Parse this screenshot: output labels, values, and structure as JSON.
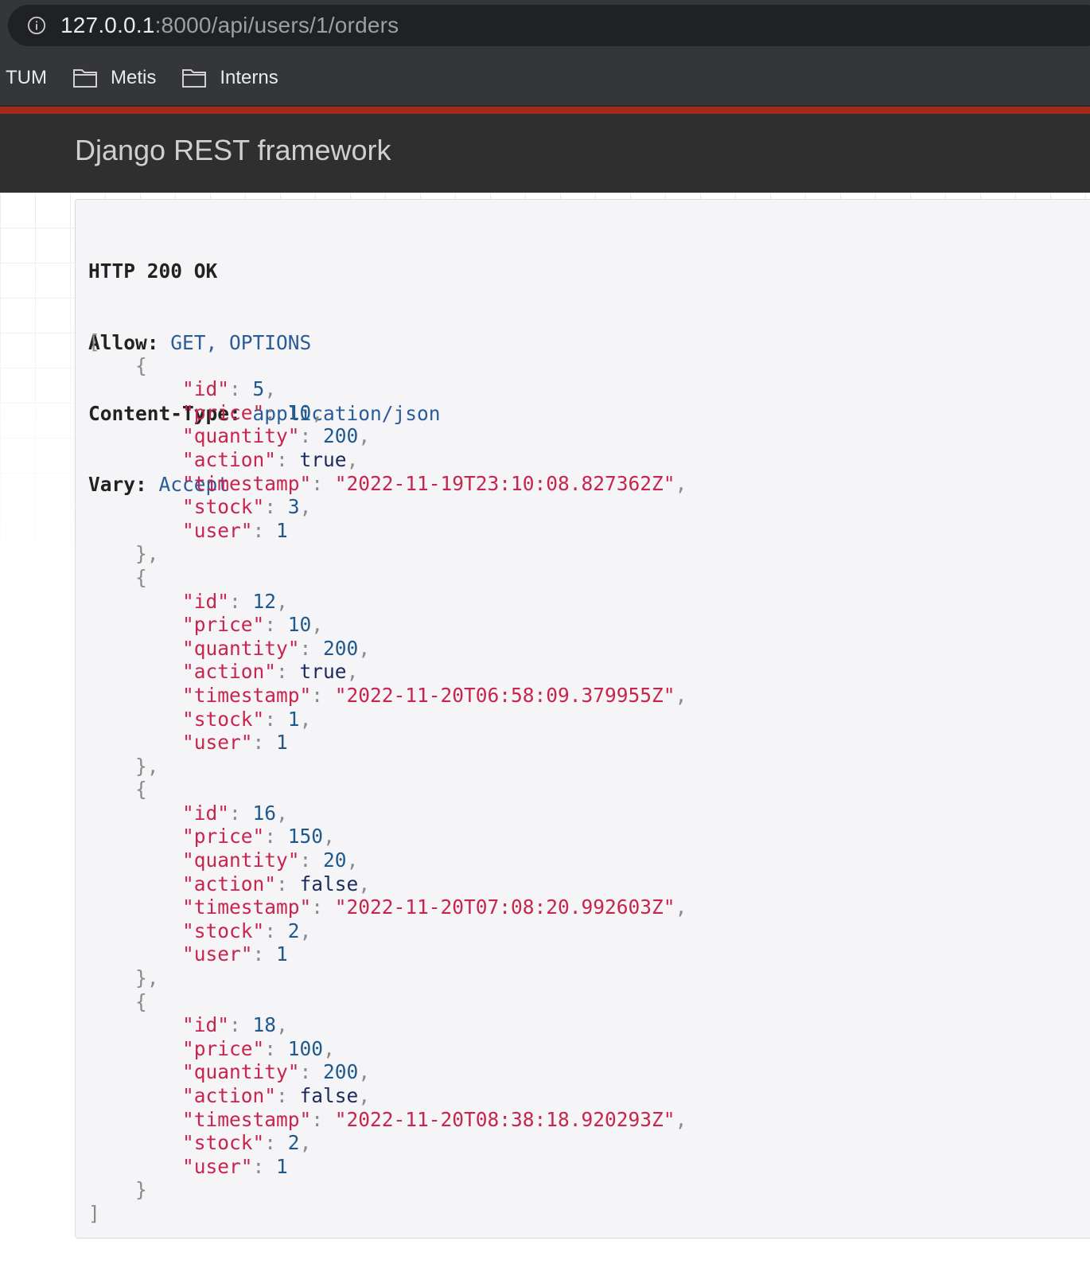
{
  "browser": {
    "url_host": "127.0.0.1",
    "url_path": ":8000/api/users/1/orders",
    "bookmarks": [
      {
        "label": "TUM",
        "folder": false
      },
      {
        "label": "Metis",
        "folder": true
      },
      {
        "label": "Interns",
        "folder": true
      }
    ]
  },
  "navbar": {
    "brand": "Django REST framework",
    "accent_color": "#a52a1a"
  },
  "response": {
    "status": "HTTP 200 OK",
    "headers": [
      {
        "name": "Allow:",
        "value": "GET, OPTIONS"
      },
      {
        "name": "Content-Type:",
        "value": "application/json"
      },
      {
        "name": "Vary:",
        "value": "Accept"
      }
    ],
    "body": [
      {
        "id": "5",
        "price": "10",
        "quantity": "200",
        "action": "true",
        "timestamp": "\"2022-11-19T23:10:08.827362Z\"",
        "stock": "3",
        "user": "1"
      },
      {
        "id": "12",
        "price": "10",
        "quantity": "200",
        "action": "true",
        "timestamp": "\"2022-11-20T06:58:09.379955Z\"",
        "stock": "1",
        "user": "1"
      },
      {
        "id": "16",
        "price": "150",
        "quantity": "20",
        "action": "false",
        "timestamp": "\"2022-11-20T07:08:20.992603Z\"",
        "stock": "2",
        "user": "1"
      },
      {
        "id": "18",
        "price": "100",
        "quantity": "200",
        "action": "false",
        "timestamp": "\"2022-11-20T08:38:18.920293Z\"",
        "stock": "2",
        "user": "1"
      }
    ],
    "field_order": [
      "id",
      "price",
      "quantity",
      "action",
      "timestamp",
      "stock",
      "user"
    ]
  }
}
